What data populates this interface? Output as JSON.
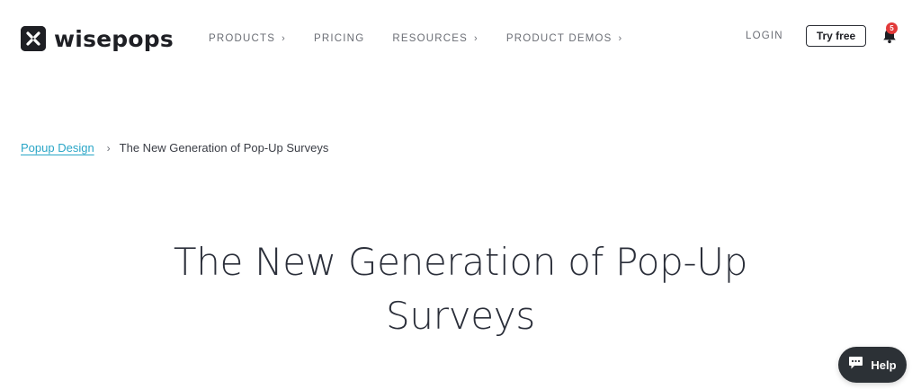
{
  "header": {
    "brand": "wisepops",
    "nav": [
      {
        "label": "PRODUCTS",
        "has_chevron": true
      },
      {
        "label": "PRICING",
        "has_chevron": false
      },
      {
        "label": "RESOURCES",
        "has_chevron": true
      },
      {
        "label": "PRODUCT DEMOS",
        "has_chevron": true
      }
    ],
    "login": "LOGIN",
    "try_free": "Try free",
    "notification_count": "5"
  },
  "breadcrumb": {
    "parent": "Popup Design",
    "separator": "›",
    "current": "The New Generation of Pop-Up Surveys"
  },
  "title": {
    "line1": "The New Generation of Pop-Up",
    "line2": "Surveys"
  },
  "help_button": {
    "label": "Help"
  },
  "colors": {
    "accent_link": "#2aa6c7",
    "badge": "#e23a3a",
    "dark": "#1e1f24",
    "help_bg": "#2c3136"
  },
  "icons": {
    "logo": "wisepops-logo-icon",
    "chevron": "chevron-right-icon",
    "bell": "bell-icon",
    "chat": "chat-bubble-icon"
  }
}
